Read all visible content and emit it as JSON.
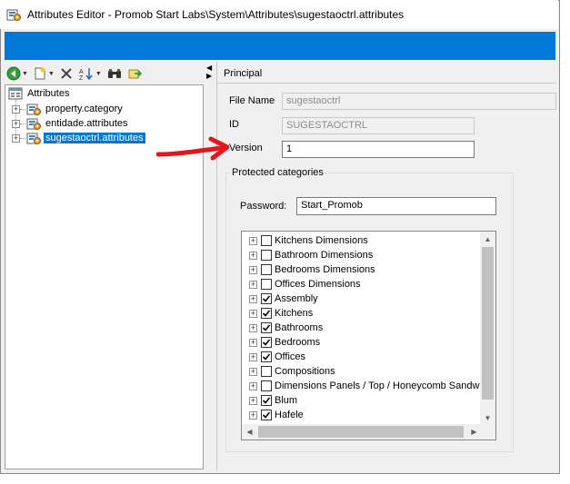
{
  "window": {
    "title": "Attributes Editor - Promob Start Labs\\System\\Attributes\\sugestaoctrl.attributes",
    "accent": "#0078d7"
  },
  "toolbar": {
    "buttons": [
      {
        "name": "back-button",
        "icon": "green-back-arrow-icon"
      },
      {
        "name": "new-button",
        "icon": "new-document-icon"
      },
      {
        "name": "delete-button",
        "icon": "delete-x-icon"
      },
      {
        "name": "sort-button",
        "icon": "sort-az-icon"
      },
      {
        "name": "find-button",
        "icon": "binoculars-icon"
      },
      {
        "name": "export-button",
        "icon": "export-icon"
      }
    ]
  },
  "tree": {
    "root": "Attributes",
    "items": [
      {
        "label": "property.category",
        "selected": false
      },
      {
        "label": "entidade.attributes",
        "selected": false
      },
      {
        "label": "sugestaoctrl.attributes",
        "selected": true
      }
    ]
  },
  "panel": {
    "title": "Principal",
    "file_name_label": "File Name",
    "file_name_value": "sugestaoctrl",
    "id_label": "ID",
    "id_value": "SUGESTAOCTRL",
    "version_label": "Version",
    "version_value": "1",
    "protected": {
      "title": "Protected categories",
      "password_label": "Password:",
      "password_value": "Start_Promob",
      "categories": [
        {
          "label": "Kitchens Dimensions",
          "checked": false
        },
        {
          "label": "Bathroom Dimensions",
          "checked": false
        },
        {
          "label": "Bedrooms Dimensions",
          "checked": false
        },
        {
          "label": "Offices Dimensions",
          "checked": false
        },
        {
          "label": "Assembly",
          "checked": true
        },
        {
          "label": "Kitchens",
          "checked": true
        },
        {
          "label": "Bathrooms",
          "checked": true
        },
        {
          "label": "Bedrooms",
          "checked": true
        },
        {
          "label": "Offices",
          "checked": true
        },
        {
          "label": "Compositions",
          "checked": false
        },
        {
          "label": "Dimensions Panels / Top / Honeycomb Sandwi",
          "checked": false
        },
        {
          "label": "Blum",
          "checked": true
        },
        {
          "label": "Hafele",
          "checked": true
        }
      ]
    }
  },
  "annotation": {
    "color": "#e8141b"
  }
}
